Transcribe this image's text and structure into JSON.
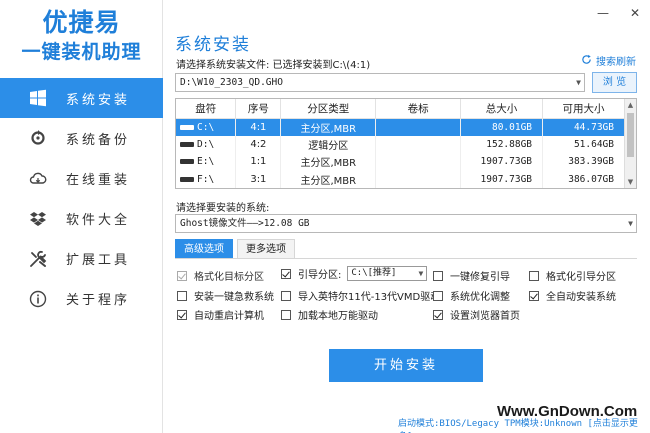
{
  "app": {
    "logo_title": "优捷易",
    "logo_subtitle": "一键装机助理",
    "win_minimize": "—",
    "win_close": "✕"
  },
  "sidebar": {
    "items": [
      {
        "label": "系统安装",
        "icon": "windows-icon",
        "active": true
      },
      {
        "label": "系统备份",
        "icon": "backup-icon",
        "active": false
      },
      {
        "label": "在线重装",
        "icon": "cloud-icon",
        "active": false
      },
      {
        "label": "软件大全",
        "icon": "dropbox-icon",
        "active": false
      },
      {
        "label": "扩展工具",
        "icon": "tools-icon",
        "active": false
      },
      {
        "label": "关于程序",
        "icon": "info-icon",
        "active": false
      }
    ]
  },
  "main": {
    "title": "系统安装",
    "refresh_label": "搜索刷新",
    "file_label": "请选择系统安装文件: 已选择安装到C:\\(4:1)",
    "file_path": "D:\\W10_2303_QD.GHO",
    "browse_label": "浏 览",
    "system_label": "请选择要安装的系统:",
    "system_value": "Ghost镜像文件——>12.08 GB",
    "start_label": "开始安装"
  },
  "partition_table": {
    "headers": [
      "盘符",
      "序号",
      "分区类型",
      "卷标",
      "总大小",
      "可用大小"
    ],
    "rows": [
      {
        "drive": "C:\\",
        "index": "4:1",
        "type": "主分区,MBR",
        "label": "",
        "total": "80.01GB",
        "free": "44.73GB",
        "selected": true
      },
      {
        "drive": "D:\\",
        "index": "4:2",
        "type": "逻辑分区",
        "label": "",
        "total": "152.88GB",
        "free": "51.64GB",
        "selected": false
      },
      {
        "drive": "E:\\",
        "index": "1:1",
        "type": "主分区,MBR",
        "label": "",
        "total": "1907.73GB",
        "free": "383.39GB",
        "selected": false
      },
      {
        "drive": "F:\\",
        "index": "3:1",
        "type": "主分区,MBR",
        "label": "",
        "total": "1907.73GB",
        "free": "386.07GB",
        "selected": false
      }
    ]
  },
  "tabs": [
    {
      "label": "高级选项",
      "active": true
    },
    {
      "label": "更多选项",
      "active": false
    }
  ],
  "options": {
    "format_target": {
      "label": "格式化目标分区",
      "checked": true,
      "disabled": true
    },
    "boot_partition": {
      "label": "引导分区:",
      "checked": true
    },
    "boot_partition_value": "C:\\[推荐]",
    "one_key_boot_fix": {
      "label": "一键修复引导",
      "checked": false
    },
    "format_boot": {
      "label": "格式化引导分区",
      "checked": false
    },
    "install_rescue": {
      "label": "安装一键急救系统",
      "checked": false
    },
    "import_intel": {
      "label": "导入英特尔11代-13代VMD驱动",
      "checked": false
    },
    "sys_optimize": {
      "label": "系统优化调整",
      "checked": false
    },
    "auto_install": {
      "label": "全自动安装系统",
      "checked": true
    },
    "auto_restart": {
      "label": "自动重启计算机",
      "checked": true
    },
    "load_driver": {
      "label": "加载本地万能驱动",
      "checked": false
    },
    "set_homepage": {
      "label": "设置浏览器首页",
      "checked": true
    }
  },
  "footer": {
    "boot_mode": "启动模式:BIOS/Legacy TPM模块:Unknown [点击显示更多]",
    "watermark": "Www.GnDown.Com"
  },
  "colors": {
    "accent": "#2c8ee8",
    "brand": "#1f7fd9"
  }
}
